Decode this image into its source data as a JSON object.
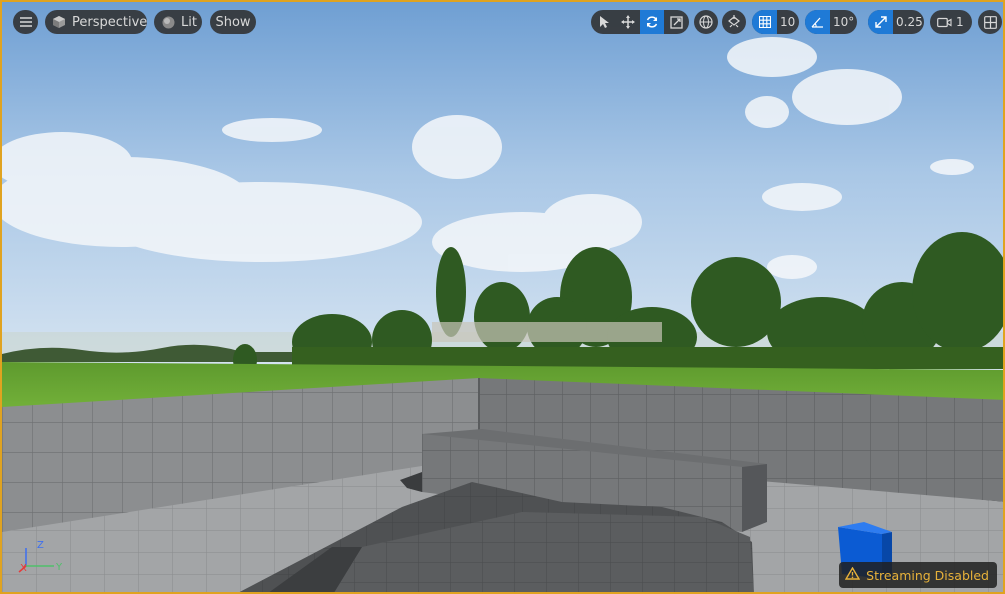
{
  "toolbar_left": {
    "menu_icon": "hamburger-icon",
    "view_mode": {
      "icon": "cube-icon",
      "label": "Perspective"
    },
    "lighting": {
      "icon": "sphere-icon",
      "label": "Lit"
    },
    "show": {
      "label": "Show"
    }
  },
  "toolbar_right": {
    "transform_tools": [
      {
        "name": "select",
        "icon": "cursor-icon",
        "active": false
      },
      {
        "name": "translate",
        "icon": "move-icon",
        "active": false
      },
      {
        "name": "rotate",
        "icon": "rotate-icon",
        "active": true
      },
      {
        "name": "scale",
        "icon": "scale-icon",
        "active": false
      }
    ],
    "coordinate_space_icon": "globe-icon",
    "surface_snap_icon": "surface-snap-icon",
    "grid_snap": {
      "icon": "grid-icon",
      "value": "10"
    },
    "rotation_snap": {
      "icon": "angle-icon",
      "value": "10°"
    },
    "scale_snap": {
      "icon": "scale-snap-icon",
      "value": "0.25"
    },
    "camera_speed": {
      "icon": "camera-icon",
      "value": "1"
    },
    "layout_icon": "viewport-layout-icon"
  },
  "axis_gizmo": {
    "x": "X",
    "y": "Y",
    "z": "Z"
  },
  "status": {
    "icon": "warning-icon",
    "text": "Streaming Disabled"
  },
  "colors": {
    "accent_blue": "#1f7ad6",
    "viewport_border": "#e0a320",
    "warning": "#e8b23a"
  }
}
